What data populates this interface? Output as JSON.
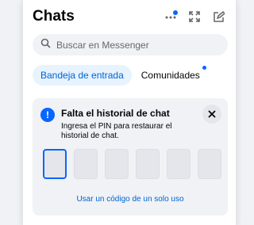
{
  "header": {
    "title": "Chats",
    "icons": [
      "more-options-icon",
      "expand-icon",
      "new-message-icon"
    ]
  },
  "search": {
    "placeholder": "Buscar en Messenger"
  },
  "tabs": [
    {
      "label": "Bandeja de entrada",
      "active": true
    },
    {
      "label": "Comunidades",
      "active": false
    }
  ],
  "notice": {
    "title": "Falta el historial de chat",
    "description": "Ingresa el PIN para restaurar el historial de chat.",
    "pin_slots": 6,
    "link": "Usar un código de un solo uso"
  },
  "colors": {
    "accent": "#0866ff",
    "link": "#0064d1",
    "card_bg": "#f0f2f5"
  }
}
